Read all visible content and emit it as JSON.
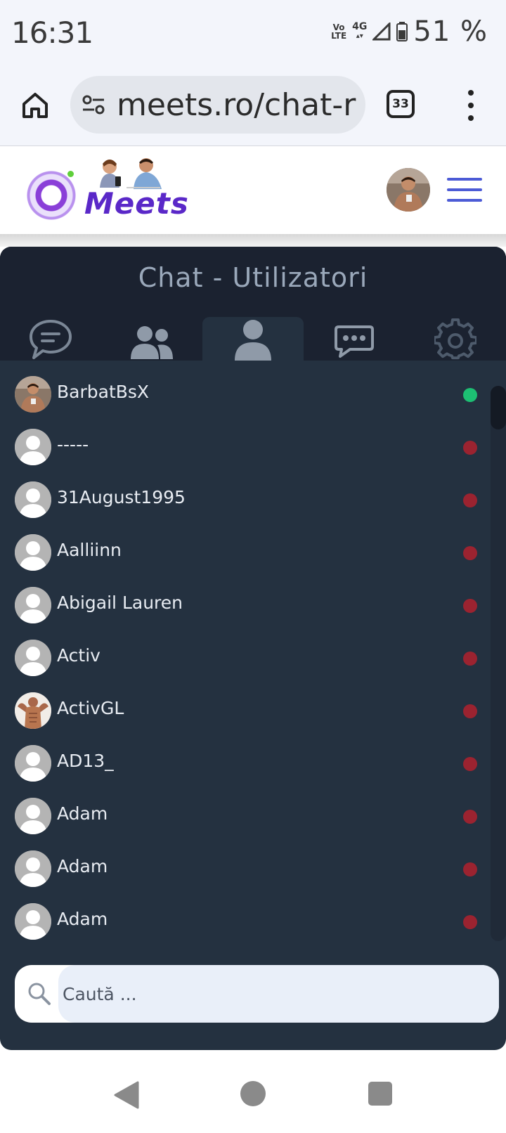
{
  "status_bar": {
    "time": "16:31",
    "volte_top": "Vo",
    "volte_bottom": "LTE",
    "network": "4G",
    "battery": "51 %"
  },
  "browser": {
    "url": "meets.ro/chat-r",
    "tab_count": "33",
    "home_icon": "home-icon",
    "menu_icon": "more-vert-icon"
  },
  "site": {
    "logo_text": "Meets"
  },
  "chat": {
    "title": "Chat - Utilizatori",
    "tabs": [
      {
        "icon": "chat-bubble-icon",
        "active": false
      },
      {
        "icon": "users-group-icon",
        "active": false
      },
      {
        "icon": "user-icon",
        "active": true
      },
      {
        "icon": "message-dots-icon",
        "active": false
      },
      {
        "icon": "settings-gear-icon",
        "active": false
      }
    ],
    "users": [
      {
        "name": "BarbatBsX",
        "online": true,
        "photo": true
      },
      {
        "name": "-----",
        "online": false,
        "photo": false
      },
      {
        "name": "31August1995",
        "online": false,
        "photo": false
      },
      {
        "name": "Aalliinn",
        "online": false,
        "photo": false
      },
      {
        "name": "Abigail Lauren",
        "online": false,
        "photo": false
      },
      {
        "name": "Activ",
        "online": false,
        "photo": false
      },
      {
        "name": "ActivGL",
        "online": false,
        "photo": true
      },
      {
        "name": "AD13_",
        "online": false,
        "photo": false
      },
      {
        "name": "Adam",
        "online": false,
        "photo": false
      },
      {
        "name": "Adam",
        "online": false,
        "photo": false
      },
      {
        "name": "Adam",
        "online": false,
        "photo": false
      }
    ],
    "search_placeholder": "Caută ..."
  },
  "colors": {
    "online": "#1dbf73",
    "offline": "#9b2330",
    "panel": "#243140",
    "panel_header": "#1b2230"
  }
}
